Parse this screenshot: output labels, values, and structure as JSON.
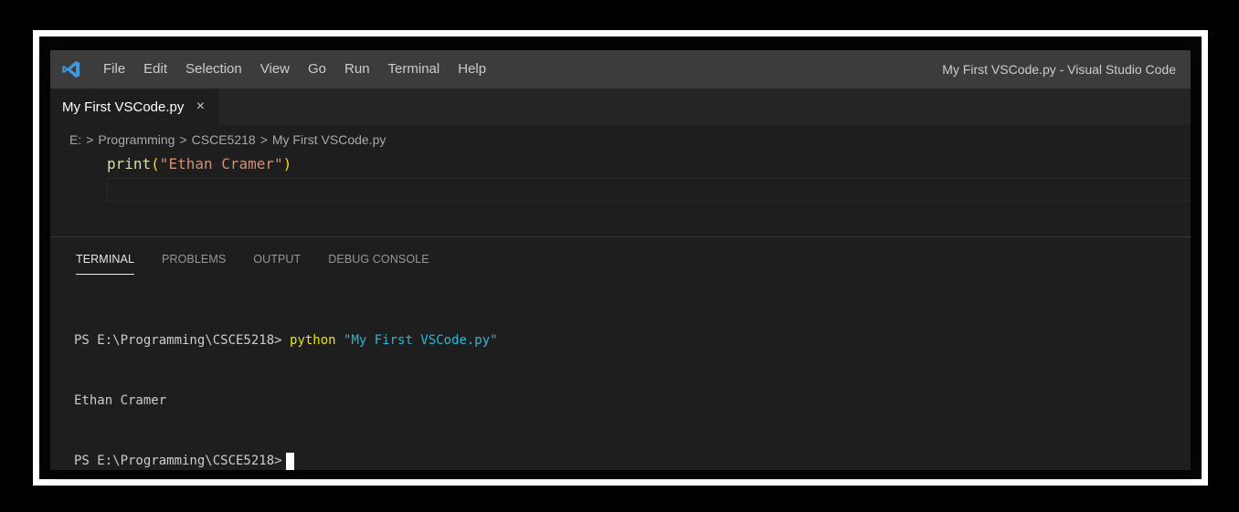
{
  "app": {
    "window_title": "My First VSCode.py - Visual Studio Code",
    "icon": "vscode-logo-icon"
  },
  "menu": {
    "items": [
      "File",
      "Edit",
      "Selection",
      "View",
      "Go",
      "Run",
      "Terminal",
      "Help"
    ]
  },
  "tabs": [
    {
      "label": "My First VSCode.py",
      "close_glyph": "×",
      "active": true
    }
  ],
  "breadcrumb": {
    "items": [
      "E:",
      "Programming",
      "CSCE5218",
      "My First VSCode.py"
    ],
    "separator": ">"
  },
  "editor": {
    "line1": {
      "fn": "print",
      "open": "(",
      "str": "\"Ethan Cramer\"",
      "close": ")"
    }
  },
  "panel": {
    "tabs": [
      {
        "label": "TERMINAL",
        "active": true
      },
      {
        "label": "PROBLEMS",
        "active": false
      },
      {
        "label": "OUTPUT",
        "active": false
      },
      {
        "label": "DEBUG CONSOLE",
        "active": false
      }
    ]
  },
  "terminal": {
    "line1": {
      "prompt": "PS E:\\Programming\\CSCE5218> ",
      "command": "python",
      "argument": " \"My First VSCode.py\""
    },
    "line2": "Ethan Cramer",
    "line3": {
      "prompt": "PS E:\\Programming\\CSCE5218>"
    }
  },
  "colors": {
    "titlebar": "#3c3c3c",
    "editor_bg": "#1e1e1e",
    "tabbar_bg": "#252526",
    "accent_blue": "#3b9ae1",
    "terminal_command": "#e5e510",
    "terminal_string": "#29b8db"
  }
}
